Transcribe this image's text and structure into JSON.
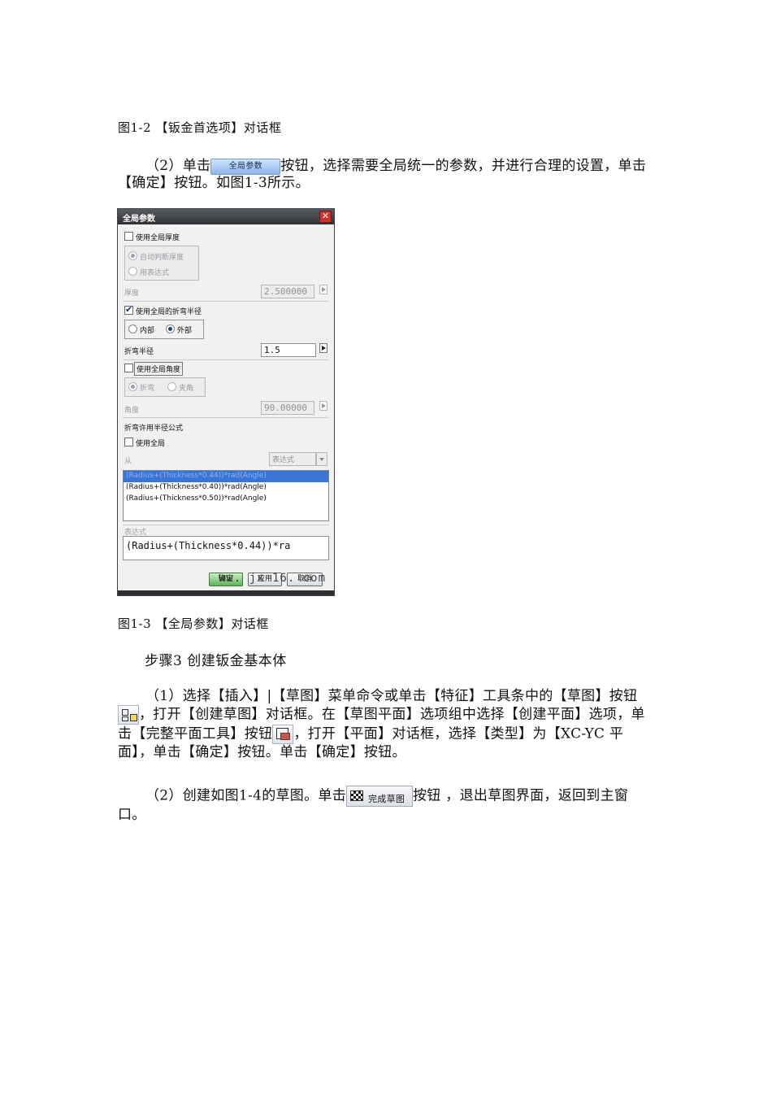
{
  "caption_1_2": "图1-2 【钣金首选项】对话框",
  "para1": {
    "before": "（2）单击",
    "button_label": "全局参数",
    "after": "按钮，选择需要全局统一的参数，并进行合理的设置，单击【确定】按钮。如图1-3所示。"
  },
  "dialog": {
    "title": "全局参数",
    "close_glyph": "✕",
    "use_global_thickness": "使用全局厚度",
    "auto_thickness": "自动判断厚度",
    "use_expression": "用表达式",
    "thickness_label": "厚度",
    "thickness_value": "2.500000",
    "use_global_bend_radius": "使用全局的折弯半径",
    "inner": "内部",
    "outer": "外部",
    "bend_radius_label": "折弯半径",
    "bend_radius_value": "1.5",
    "use_global_angle": "使用全局角度",
    "bend": "折弯",
    "included_angle": "夹角",
    "angle_label": "角度",
    "angle_value": "90.00000",
    "bend_allowance_formula": "折弯许用半径公式",
    "use_global": "使用全局",
    "from_label": "从",
    "from_select": "表达式",
    "formulas": [
      "(Radius+(Thickness*0.44))*rad(Angle)",
      "(Radius+(Thickness*0.40))*rad(Angle)",
      "(Radius+(Thickness*0.50))*rad(Angle)"
    ],
    "expression_label": "表达式",
    "expression_value": "(Radius+(Thickness*0.44))*ra",
    "ok": "确定",
    "apply": "应用",
    "cancel": "取消",
    "watermark": "ww.  jx  16. com"
  },
  "caption_1_3": "图1-3 【全局参数】对话框",
  "step3": "步骤3 创建钣金基本体",
  "para2": {
    "part1": "（1）选择【插入】|【草图】菜单命令或单击【特征】工具条中的【草图】按钮",
    "part2": "，打开【创建草图】对话框。在【草图平面】选项组中选择【创建平面】选项，单击【完整平面工具】按钮",
    "part3": "，打开【平面】对话框，选择【类型】为【XC-YC 平面】，单击【确定】按钮。单击【确定】按钮。"
  },
  "para3": {
    "before": "（2）创建如图1-4的草图。单击",
    "button_label": "完成草图",
    "after": "按钮 ，退出草图界面，返回到主窗口。"
  }
}
